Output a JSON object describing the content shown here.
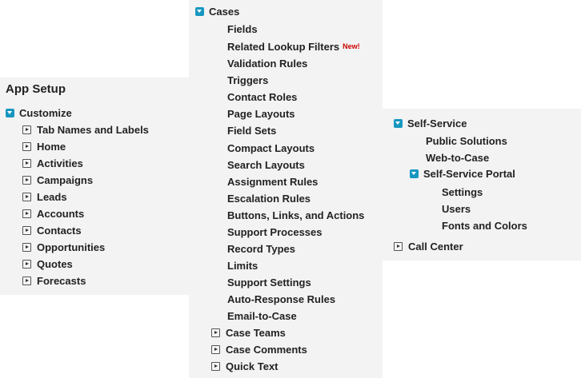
{
  "app_setup": {
    "title": "App Setup",
    "customize": {
      "label": "Customize",
      "items": [
        "Tab Names and Labels",
        "Home",
        "Activities",
        "Campaigns",
        "Leads",
        "Accounts",
        "Contacts",
        "Opportunities",
        "Quotes",
        "Forecasts"
      ]
    }
  },
  "cases": {
    "label": "Cases",
    "items": [
      "Fields",
      "Related Lookup Filters",
      "Validation Rules",
      "Triggers",
      "Contact Roles",
      "Page Layouts",
      "Field Sets",
      "Compact Layouts",
      "Search Layouts",
      "Assignment Rules",
      "Escalation Rules",
      "Buttons, Links, and Actions",
      "Support Processes",
      "Record Types",
      "Limits",
      "Support Settings",
      "Auto-Response Rules",
      "Email-to-Case"
    ],
    "new_badge": "New!",
    "collapsed_items": [
      "Case Teams",
      "Case Comments",
      "Quick Text"
    ]
  },
  "self_service": {
    "label": "Self-Service",
    "items": [
      "Public Solutions",
      "Web-to-Case"
    ],
    "portal": {
      "label": "Self-Service Portal",
      "items": [
        "Settings",
        "Users",
        "Fonts and Colors"
      ]
    }
  },
  "call_center": {
    "label": "Call Center"
  },
  "colors": {
    "expand_icon": "#1797c0",
    "new_badge": "#cc0000",
    "panel_background": "#f3f3f3"
  }
}
